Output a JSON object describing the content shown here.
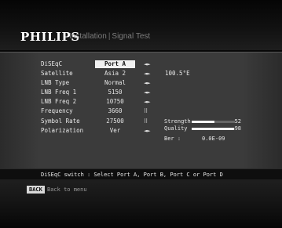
{
  "header": {
    "brand": "PHILIPS",
    "breadcrumb_installation": "Installation",
    "breadcrumb_separator": "|",
    "breadcrumb_signal_test": "Signal Test"
  },
  "settings": [
    {
      "label": "DiSEqC",
      "value": "Port A",
      "control": "arrows",
      "selected": true
    },
    {
      "label": "Satellite",
      "value": "Asia 2",
      "control": "arrows",
      "extra": "100.5°E"
    },
    {
      "label": "LNB Type",
      "value": "Normal",
      "control": "arrows"
    },
    {
      "label": "LNB Freq 1",
      "value": "5150",
      "control": "arrows"
    },
    {
      "label": "LNB Freq 2",
      "value": "10750",
      "control": "arrows"
    },
    {
      "label": "Frequency",
      "value": "3660",
      "control": "keypad"
    },
    {
      "label": "Symbol Rate",
      "value": "27500",
      "control": "keypad"
    },
    {
      "label": "Polarization",
      "value": "Ver",
      "control": "arrows"
    }
  ],
  "signal": {
    "strength_label": "Strength",
    "strength_value": "52",
    "strength_percent": 52,
    "quality_label": "Quality",
    "quality_value": "98",
    "quality_percent": 98,
    "ber_label": "Ber :",
    "ber_value": "0.0E-09"
  },
  "status_bar": {
    "help_text": "DiSEqC switch : Select Port A, Port B, Port C or Port D"
  },
  "footer": {
    "back_key": "BACK",
    "back_text": "Back to menu"
  },
  "icons": {
    "arrows": "left-right-arrows-icon",
    "keypad": "numeric-keypad-icon"
  },
  "colors": {
    "selected_bg": "#f1f1f1",
    "panel_bg": "#3b3b3b",
    "bar_fill": "#ffffff"
  }
}
